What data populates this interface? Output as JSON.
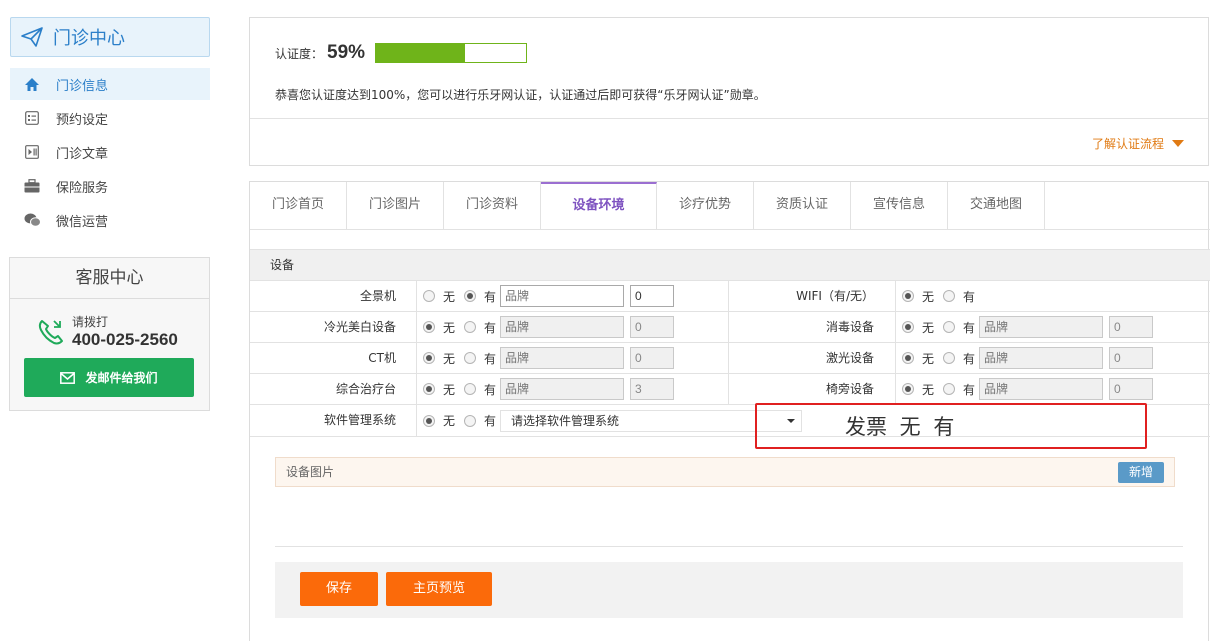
{
  "sidebar": {
    "brand": "门诊中心",
    "items": [
      {
        "label": "门诊信息",
        "icon": "home-icon",
        "active": true
      },
      {
        "label": "预约设定",
        "icon": "appointment-icon",
        "active": false
      },
      {
        "label": "门诊文章",
        "icon": "article-icon",
        "active": false
      },
      {
        "label": "保险服务",
        "icon": "briefcase-icon",
        "active": false
      },
      {
        "label": "微信运营",
        "icon": "wechat-icon",
        "active": false
      }
    ],
    "service": {
      "title": "客服中心",
      "call_label": "请拨打",
      "phone": "400-025-2560",
      "email_button": "发邮件给我们"
    }
  },
  "certification": {
    "label": "认证度：",
    "percent_text": "59%",
    "progress": 0.59,
    "message": "恭喜您认证度达到100%，您可以进行乐牙网认证，认证通过后即可获得“乐牙网认证”勋章。",
    "learn_link": "了解认证流程"
  },
  "tabs": [
    "门诊首页",
    "门诊图片",
    "门诊资料",
    "设备环境",
    "诊疗优势",
    "资质认证",
    "宣传信息",
    "交通地图"
  ],
  "active_tab": 3,
  "equipment": {
    "section_title": "设备",
    "no_label": "无",
    "yes_label": "有",
    "brand_placeholder": "品牌",
    "rows": [
      {
        "left": {
          "label": "全景机",
          "value": "yes",
          "quantity": "0",
          "enabled": true
        },
        "right": {
          "label": "WIFI（有/无）",
          "value": "no",
          "has_inputs": false
        }
      },
      {
        "left": {
          "label": "冷光美白设备",
          "value": "no",
          "quantity": "0",
          "enabled": false
        },
        "right": {
          "label": "消毒设备",
          "value": "no",
          "quantity": "0",
          "enabled": false,
          "has_inputs": true
        }
      },
      {
        "left": {
          "label": "CT机",
          "value": "no",
          "quantity": "0",
          "enabled": false
        },
        "right": {
          "label": "激光设备",
          "value": "no",
          "quantity": "0",
          "enabled": false,
          "has_inputs": true
        }
      },
      {
        "left": {
          "label": "综合治疗台",
          "value": "no",
          "quantity": "3",
          "enabled": false
        },
        "right": {
          "label": "椅旁设备",
          "value": "no",
          "quantity": "0",
          "enabled": false,
          "has_inputs": true
        }
      }
    ],
    "software": {
      "label": "软件管理系统",
      "value": "no",
      "select_value": "请选择软件管理系统"
    }
  },
  "annotation": "发票 无 有",
  "annotation_color": "#e02020",
  "device_pictures": {
    "label": "设备图片",
    "add_button": "新增"
  },
  "actions": {
    "save": "保存",
    "preview": "主页预览"
  },
  "colors": {
    "accent": "#2b7fc9",
    "progress": "#6fb41a",
    "orange": "#fb6a0a",
    "green": "#1faa5a",
    "tab_active": "#7e52c0"
  }
}
